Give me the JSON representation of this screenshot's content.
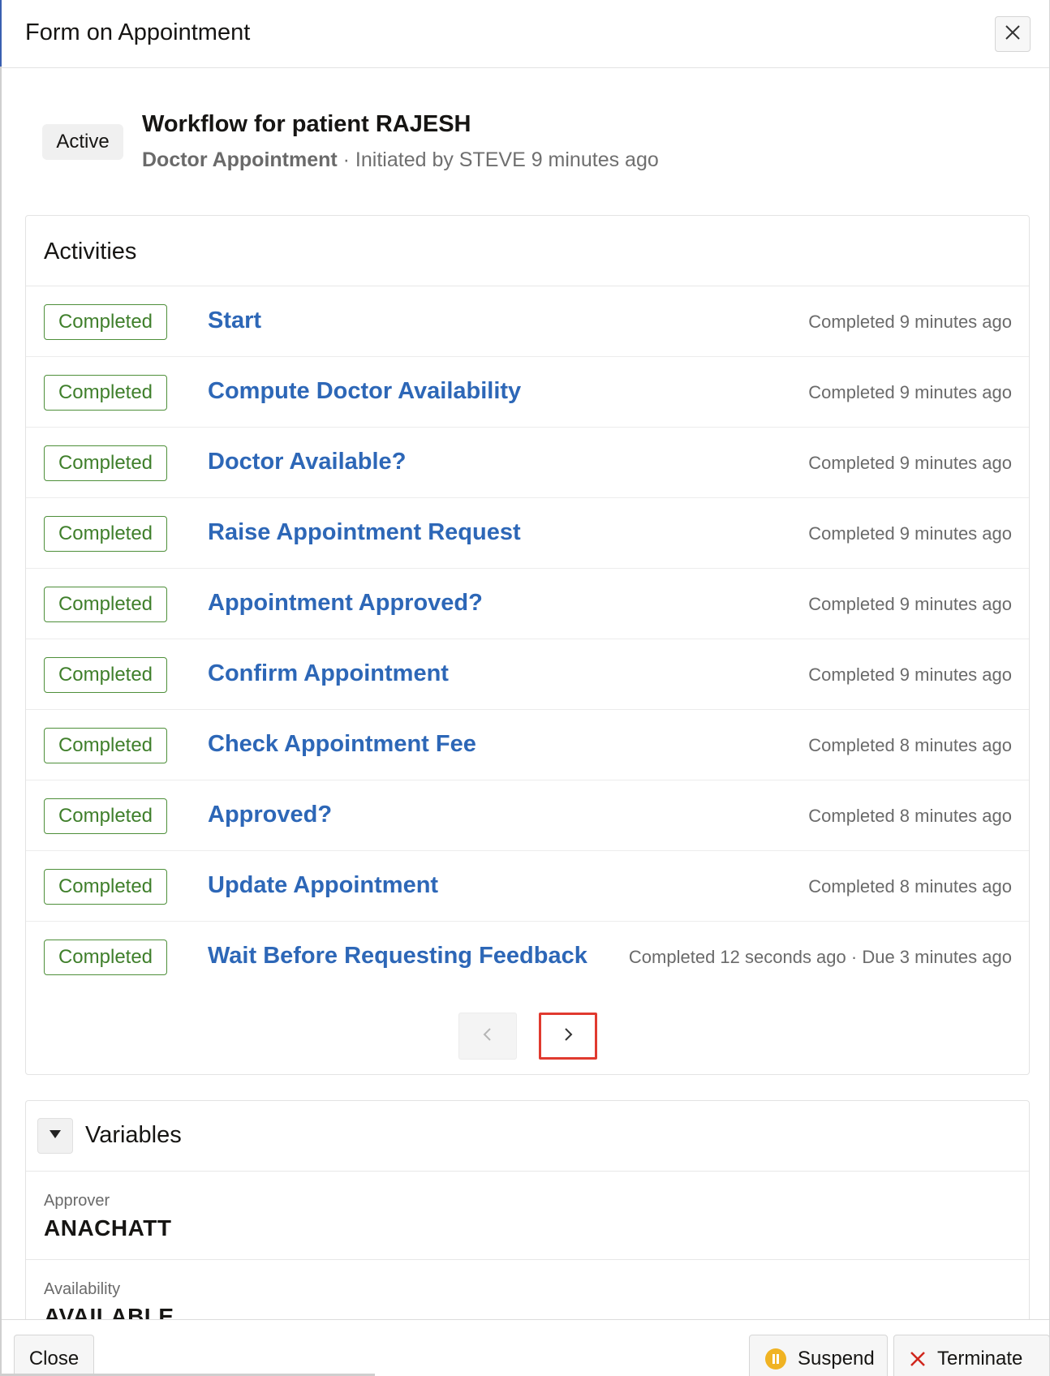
{
  "dialog": {
    "title": "Form on Appointment",
    "close_icon": "close-icon"
  },
  "summary": {
    "status": "Active",
    "title": "Workflow for patient RAJESH",
    "type": "Doctor Appointment",
    "initiated": " · Initiated by STEVE 9 minutes ago"
  },
  "activities": {
    "title": "Activities",
    "items": [
      {
        "status": "Completed",
        "name": "Start",
        "time": "Completed 9 minutes ago"
      },
      {
        "status": "Completed",
        "name": "Compute Doctor Availability",
        "time": "Completed 9 minutes ago"
      },
      {
        "status": "Completed",
        "name": "Doctor Available?",
        "time": "Completed 9 minutes ago"
      },
      {
        "status": "Completed",
        "name": "Raise Appointment Request",
        "time": "Completed 9 minutes ago"
      },
      {
        "status": "Completed",
        "name": "Appointment Approved?",
        "time": "Completed 9 minutes ago"
      },
      {
        "status": "Completed",
        "name": "Confirm Appointment",
        "time": "Completed 9 minutes ago"
      },
      {
        "status": "Completed",
        "name": "Check Appointment Fee",
        "time": "Completed 8 minutes ago"
      },
      {
        "status": "Completed",
        "name": "Approved?",
        "time": "Completed 8 minutes ago"
      },
      {
        "status": "Completed",
        "name": "Update Appointment",
        "time": "Completed 8 minutes ago"
      },
      {
        "status": "Completed",
        "name": "Wait Before Requesting Feedback",
        "time": "Completed 12 seconds ago · Due 3 minutes ago"
      }
    ],
    "pager": {
      "prev_icon": "chevron-left-icon",
      "next_icon": "chevron-right-icon"
    }
  },
  "variables": {
    "title": "Variables",
    "items": [
      {
        "label": "Approver",
        "value": "ANACHATT"
      },
      {
        "label": "Availability",
        "value": "AVAILABLE"
      }
    ]
  },
  "footer": {
    "close_label": "Close",
    "suspend_label": "Suspend",
    "terminate_label": "Terminate"
  },
  "colors": {
    "accent_link": "#2d67b7",
    "completed_green": "#3f7f2b",
    "highlight_red": "#e03a2f",
    "suspend_yellow": "#f0b323",
    "terminate_red": "#d0271d"
  }
}
